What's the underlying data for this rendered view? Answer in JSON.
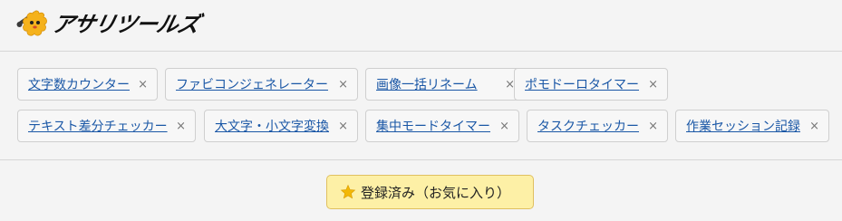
{
  "header": {
    "logo_text": "アサリツールズ",
    "logo_icon": "mascot-wrench-icon"
  },
  "tools": {
    "row1": [
      {
        "label": "文字数カウンター",
        "close": "×"
      },
      {
        "label": "ファビコンジェネレーター",
        "close": "×"
      },
      {
        "label": "画像一括リネーム",
        "close": "×"
      },
      {
        "label": "ポモドーロタイマー",
        "close": "×"
      }
    ],
    "row2": [
      {
        "label": "テキスト差分チェッカー",
        "close": "×"
      },
      {
        "label": "大文字・小文字変換",
        "close": "×"
      },
      {
        "label": "集中モードタイマー",
        "close": "×"
      },
      {
        "label": "タスクチェッカー",
        "close": "×"
      },
      {
        "label": "作業セッション記録",
        "close": "×"
      }
    ]
  },
  "favorite": {
    "icon": "star-icon",
    "label": "登録済み（お気に入り）"
  },
  "colors": {
    "link": "#1a57a6",
    "fav_bg": "#fdf0a6",
    "star": "#f2b807",
    "mascot": "#f5b21c"
  }
}
